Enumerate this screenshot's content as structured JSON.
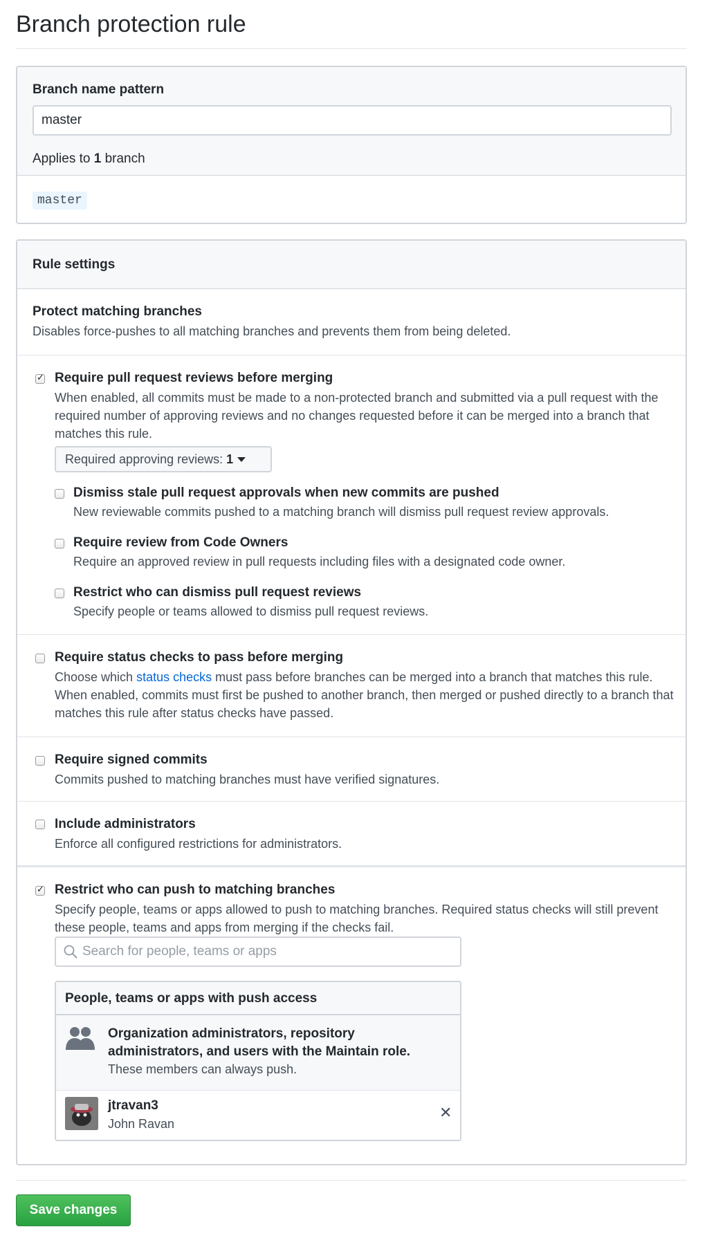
{
  "page": {
    "title": "Branch protection rule"
  },
  "branch_pattern": {
    "label": "Branch name pattern",
    "value": "master",
    "applies_prefix": "Applies to ",
    "applies_count": "1",
    "applies_suffix": " branch",
    "matched_branches": [
      "master"
    ]
  },
  "rule_settings": {
    "header": "Rule settings",
    "protect": {
      "title": "Protect matching branches",
      "desc": "Disables force-pushes to all matching branches and prevents them from being deleted."
    },
    "pr_reviews": {
      "checked": true,
      "title": "Require pull request reviews before merging",
      "desc": "When enabled, all commits must be made to a non-protected branch and submitted via a pull request with the required number of approving reviews and no changes requested before it can be merged into a branch that matches this rule.",
      "dropdown_label": "Required approving reviews:",
      "dropdown_value": "1",
      "sub_options": [
        {
          "checked": false,
          "title": "Dismiss stale pull request approvals when new commits are pushed",
          "desc": "New reviewable commits pushed to a matching branch will dismiss pull request review approvals."
        },
        {
          "checked": false,
          "title": "Require review from Code Owners",
          "desc": "Require an approved review in pull requests including files with a designated code owner."
        },
        {
          "checked": false,
          "title": "Restrict who can dismiss pull request reviews",
          "desc": "Specify people or teams allowed to dismiss pull request reviews."
        }
      ]
    },
    "status_checks": {
      "checked": false,
      "title": "Require status checks to pass before merging",
      "desc_before": "Choose which ",
      "desc_link": "status checks",
      "desc_after": " must pass before branches can be merged into a branch that matches this rule. When enabled, commits must first be pushed to another branch, then merged or pushed directly to a branch that matches this rule after status checks have passed."
    },
    "signed_commits": {
      "checked": false,
      "title": "Require signed commits",
      "desc": "Commits pushed to matching branches must have verified signatures."
    },
    "include_admins": {
      "checked": false,
      "title": "Include administrators",
      "desc": "Enforce all configured restrictions for administrators."
    },
    "restrict_push": {
      "checked": true,
      "title": "Restrict who can push to matching branches",
      "desc": "Specify people, teams or apps allowed to push to matching branches. Required status checks will still prevent these people, teams and apps from merging if the checks fail.",
      "search_placeholder": "Search for people, teams or apps",
      "access_header": "People, teams or apps with push access",
      "org_title": "Organization administrators, repository administrators, and users with the Maintain role.",
      "org_desc": "These members can always push.",
      "users": [
        {
          "login": "jtravan3",
          "name": "John Ravan"
        }
      ],
      "remove_glyph": "✕"
    }
  },
  "footer": {
    "save_label": "Save changes"
  }
}
